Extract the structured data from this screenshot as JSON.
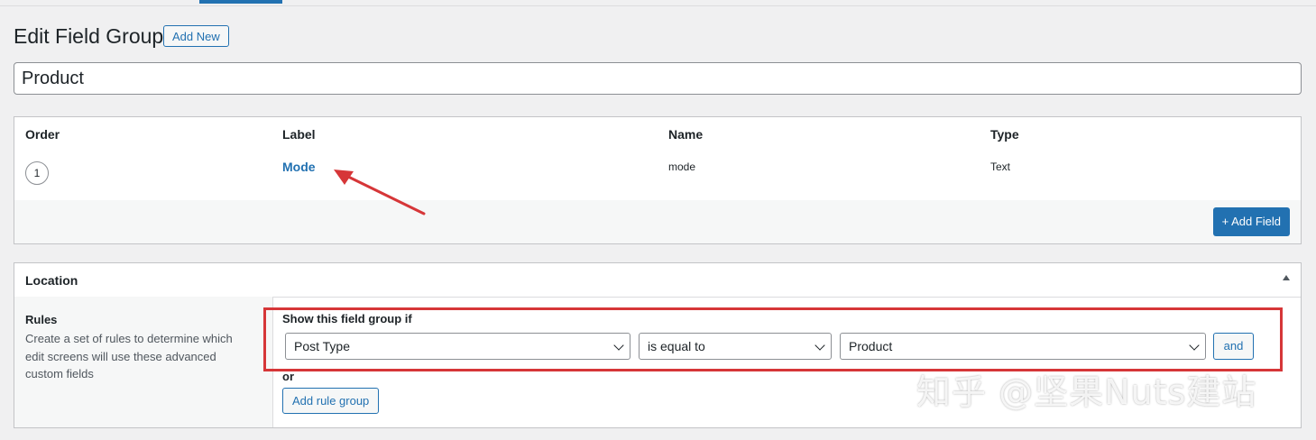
{
  "page": {
    "title": "Edit Field Group",
    "add_new_label": "Add New"
  },
  "title_input": {
    "value": "Product"
  },
  "fields_table": {
    "headers": [
      "Order",
      "Label",
      "Name",
      "Type"
    ],
    "rows": [
      {
        "order": "1",
        "label": "Mode",
        "name": "mode",
        "type": "Text"
      }
    ],
    "add_field_label": "+ Add Field"
  },
  "location": {
    "title": "Location",
    "rules_title": "Rules",
    "rules_desc": "Create a set of rules to determine which edit screens will use these advanced custom fields",
    "show_if": "Show this field group if",
    "rule": {
      "param": "Post Type",
      "operator": "is equal to",
      "value": "Product"
    },
    "and_label": "and",
    "or_label": "or",
    "add_rule_group_label": "Add rule group"
  },
  "watermark": "知乎 @坚果Nuts建站",
  "colors": {
    "accent": "#2271b1",
    "highlight": "#d63638"
  }
}
